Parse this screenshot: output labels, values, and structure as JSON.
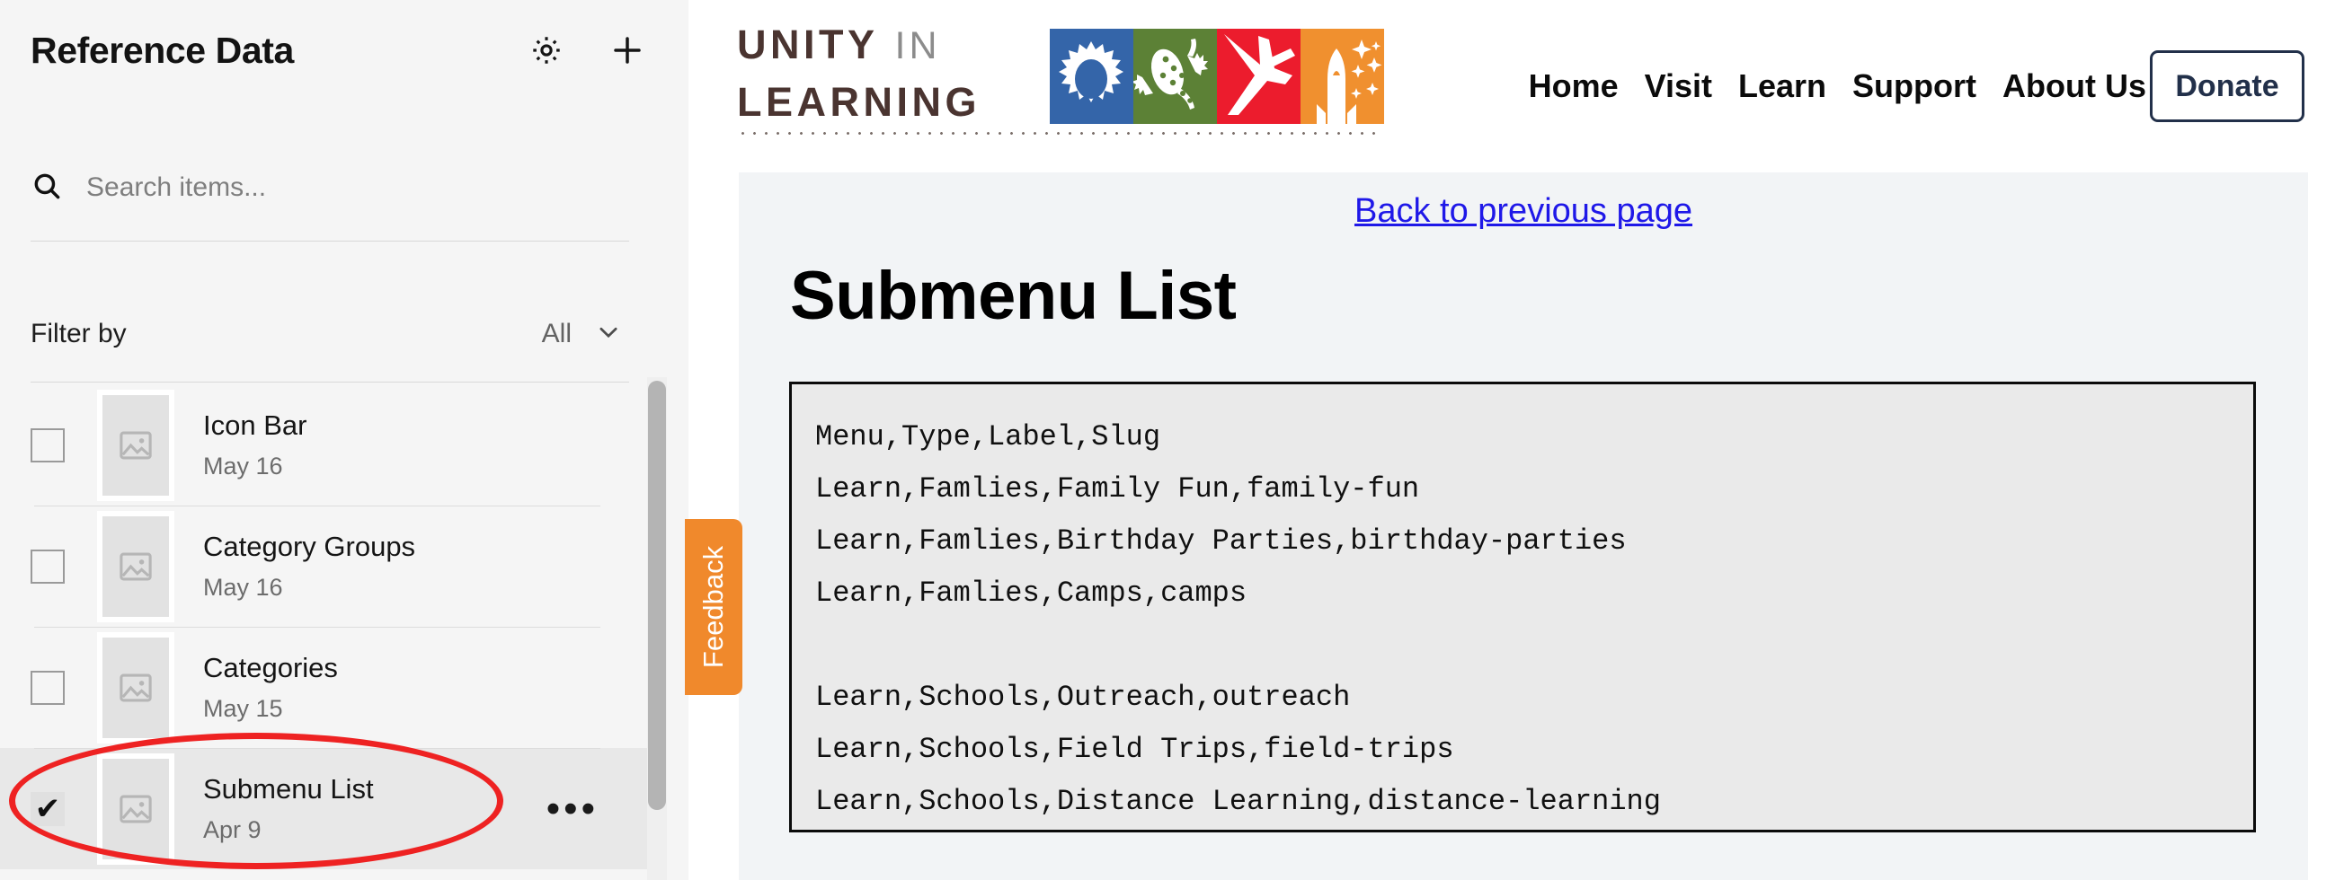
{
  "sidebar": {
    "title": "Reference Data",
    "gear_icon": "gear-icon",
    "add_icon": "plus-icon",
    "search": {
      "placeholder": "Search items...",
      "value": "",
      "icon": "search-icon"
    },
    "filter": {
      "label": "Filter by",
      "value": "All",
      "chevron_icon": "chevron-down-icon"
    },
    "items": [
      {
        "name": "Icon Bar",
        "date": "May 16",
        "checked": false,
        "selected": false
      },
      {
        "name": "Category Groups",
        "date": "May 16",
        "checked": false,
        "selected": false
      },
      {
        "name": "Categories",
        "date": "May 15",
        "checked": false,
        "selected": false
      },
      {
        "name": "Submenu List",
        "date": "Apr 9",
        "checked": true,
        "selected": true
      }
    ],
    "more_glyph": "•••",
    "check_glyph": "✔"
  },
  "site_header": {
    "logo": {
      "line1_primary": "UNITY",
      "line1_secondary": "IN",
      "line2": "LEARNING",
      "tiles": [
        {
          "name": "gear-tile",
          "color": "#3465a9"
        },
        {
          "name": "gecko-tile",
          "color": "#5c8136"
        },
        {
          "name": "airplane-tile",
          "color": "#ec1c2d"
        },
        {
          "name": "rocket-tile",
          "color": "#f0902f"
        }
      ]
    },
    "nav": [
      {
        "label": "Home"
      },
      {
        "label": "Visit"
      },
      {
        "label": "Learn"
      },
      {
        "label": "Support"
      },
      {
        "label": "About Us"
      }
    ],
    "donate_label": "Donate",
    "donate_color": "#22304a"
  },
  "content": {
    "back_link": "Back to previous page",
    "page_title": "Submenu List",
    "csv_lines": [
      "Menu,Type,Label,Slug",
      "Learn,Famlies,Family Fun,family-fun",
      "Learn,Famlies,Birthday Parties,birthday-parties",
      "Learn,Famlies,Camps,camps",
      "",
      "Learn,Schools,Outreach,outreach",
      "Learn,Schools,Field Trips,field-trips",
      "Learn,Schools,Distance Learning,distance-learning"
    ]
  },
  "feedback": {
    "label": "Feedback",
    "color": "#f0892c"
  },
  "annotation": {
    "shape": "ellipse",
    "color": "#ee2222",
    "target": "Submenu List"
  }
}
